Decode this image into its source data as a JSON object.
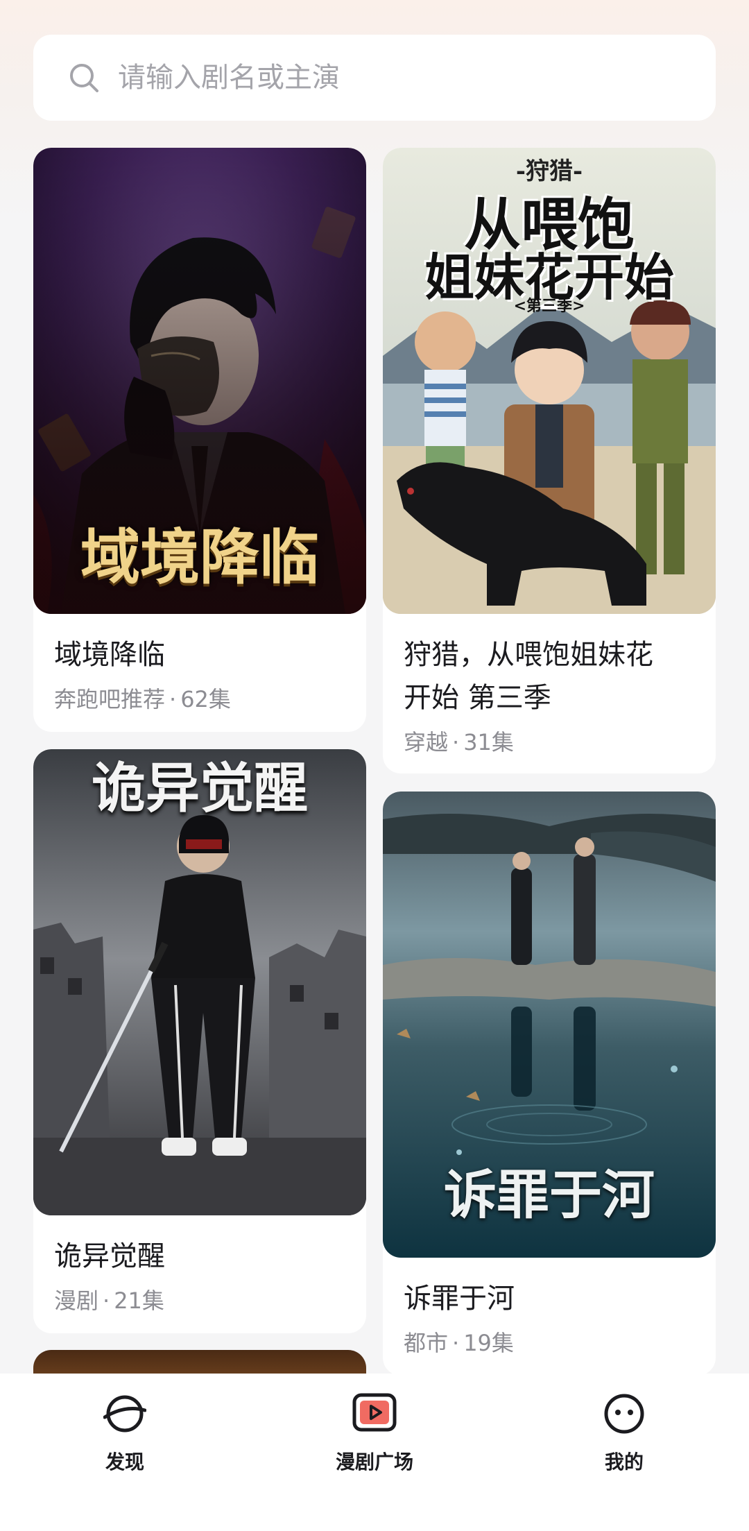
{
  "search": {
    "placeholder": "请输入剧名或主演",
    "icon": "search-icon"
  },
  "cards": [
    {
      "title": "域境降临",
      "category": "奔跑吧推荐",
      "episodes": "62集",
      "poster_text": "域境降临"
    },
    {
      "title": "狩猎，从喂饱姐妹花开始 第三季",
      "title_line1": "狩猎，从喂饱姐妹花",
      "title_line2": "开始 第三季",
      "category": "穿越",
      "episodes": "31集",
      "poster_kicker": "-狩猎-",
      "poster_line1": "从喂饱",
      "poster_line2": "姐妹花开始",
      "poster_season": "<第三季>"
    },
    {
      "title": "诡异觉醒",
      "category": "漫剧",
      "episodes": "21集",
      "poster_text": "诡异觉醒"
    },
    {
      "title": "诉罪于河",
      "category": "都市",
      "episodes": "19集",
      "poster_text": "诉罪于河"
    }
  ],
  "separator": "·",
  "nav": [
    {
      "label": "发现",
      "icon": "planet-icon"
    },
    {
      "label": "漫剧广场",
      "icon": "play-square-icon"
    },
    {
      "label": "我的",
      "icon": "smiley-face-icon"
    }
  ],
  "colors": {
    "accent": "#f06b62",
    "icon_stroke": "#1b1b1f"
  }
}
